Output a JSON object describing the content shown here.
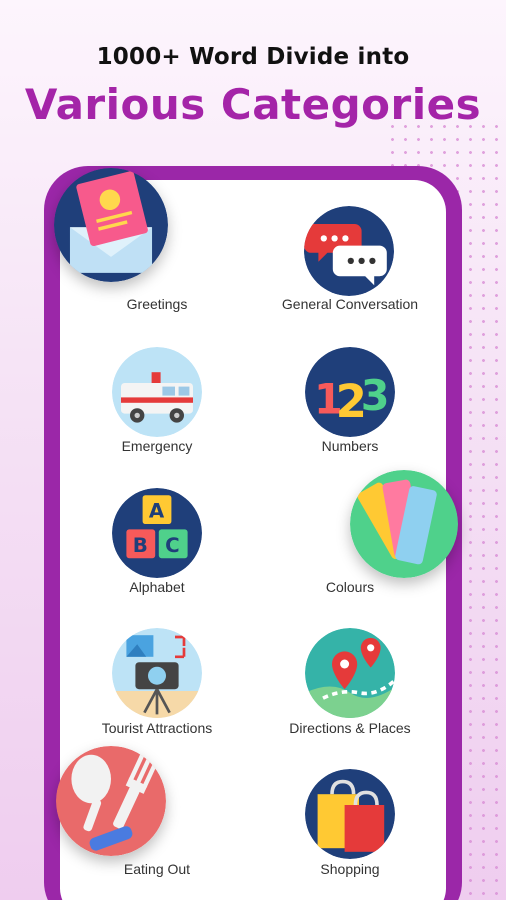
{
  "header": {
    "line1": "1000+ Word Divide into",
    "line2": "Various Categories"
  },
  "categories": [
    {
      "label": "Greetings",
      "icon": "greeting-card-icon"
    },
    {
      "label": "General Conversation",
      "icon": "chat-bubbles-icon"
    },
    {
      "label": "Emergency",
      "icon": "ambulance-icon"
    },
    {
      "label": "Numbers",
      "icon": "numbers-123-icon"
    },
    {
      "label": "Alphabet",
      "icon": "abc-blocks-icon"
    },
    {
      "label": "Colours",
      "icon": "color-swatches-icon"
    },
    {
      "label": "Tourist Attractions",
      "icon": "camera-tripod-icon"
    },
    {
      "label": "Directions & Places",
      "icon": "map-pins-icon"
    },
    {
      "label": "Eating Out",
      "icon": "spoon-fork-icon"
    },
    {
      "label": "Shopping",
      "icon": "shopping-bags-icon"
    }
  ],
  "colors": {
    "accent": "#a424a8",
    "phone_frame": "#9b27a8",
    "dots": "#d98fd6"
  }
}
